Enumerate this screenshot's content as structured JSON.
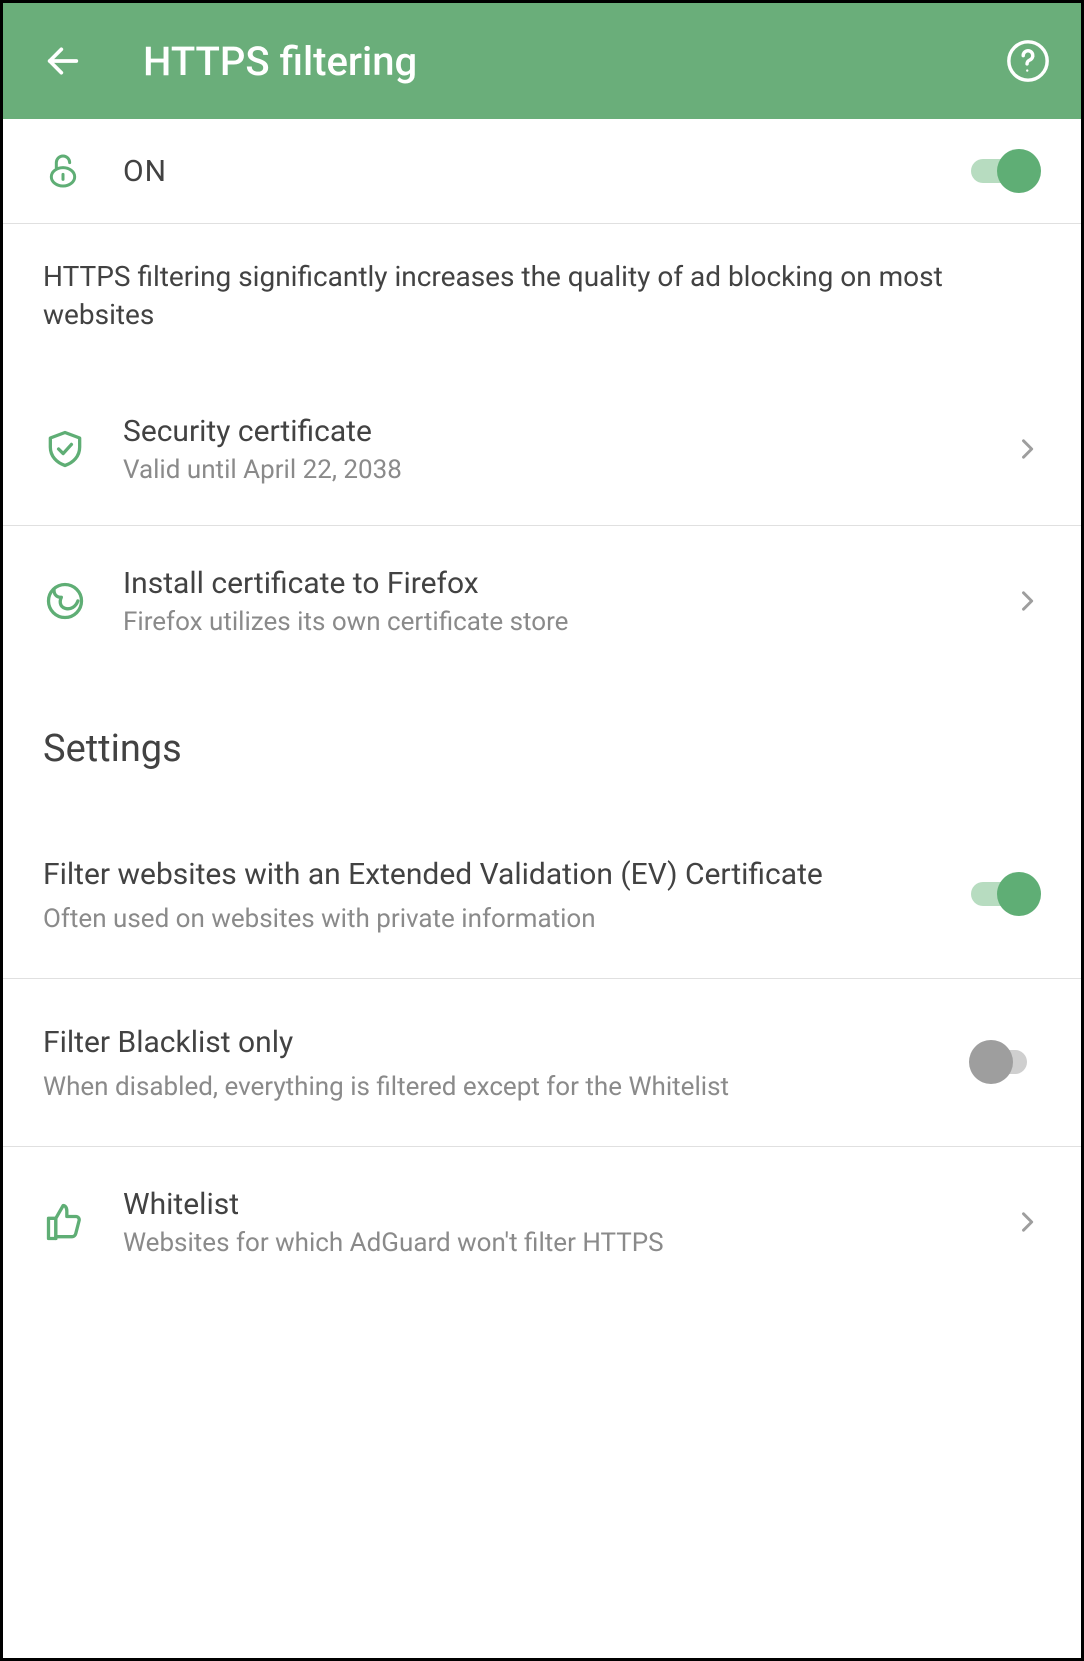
{
  "header": {
    "title": "HTTPS filtering"
  },
  "main_toggle": {
    "label": "ON",
    "state": true
  },
  "info_text": "HTTPS filtering significantly increases the quality of ad blocking on most websites",
  "security_cert": {
    "title": "Security certificate",
    "subtitle": "Valid until April 22, 2038"
  },
  "firefox_cert": {
    "title": "Install certificate to Firefox",
    "subtitle": "Firefox utilizes its own certificate store"
  },
  "settings_heading": "Settings",
  "ev_filter": {
    "title": "Filter websites with an Extended Validation (EV) Certificate",
    "subtitle": "Often used on websites with private information",
    "state": true
  },
  "blacklist_only": {
    "title": "Filter Blacklist only",
    "subtitle": "When disabled, everything is filtered except for the Whitelist",
    "state": false
  },
  "whitelist": {
    "title": "Whitelist",
    "subtitle": "Websites for which AdGuard won't filter HTTPS"
  }
}
